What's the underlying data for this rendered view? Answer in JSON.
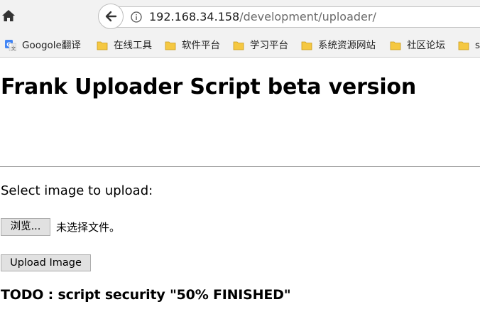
{
  "browser": {
    "url_host": "192.168.34.158",
    "url_path": "/development/uploader/",
    "bookmarks": [
      {
        "label": "Googole翻译",
        "icon": "google-translate-icon"
      },
      {
        "label": "在线工具",
        "icon": "folder-icon"
      },
      {
        "label": "软件平台",
        "icon": "folder-icon"
      },
      {
        "label": "学习平台",
        "icon": "folder-icon"
      },
      {
        "label": "系统资源网站",
        "icon": "folder-icon"
      },
      {
        "label": "社区论坛",
        "icon": "folder-icon"
      },
      {
        "label": "s",
        "icon": "folder-icon"
      }
    ]
  },
  "page": {
    "title": "Frank Uploader Script beta version",
    "select_label": "Select image to upload:",
    "browse_button": "浏览...",
    "no_file_text": "未选择文件。",
    "upload_button": "Upload Image",
    "todo": "TODO : script security \"50% FINISHED\""
  },
  "colors": {
    "chrome_bg": "#f2f2f2",
    "button_bg": "#e1e1e1",
    "folder_yellow": "#f5c842",
    "url_path_gray": "#6b6b6b"
  }
}
